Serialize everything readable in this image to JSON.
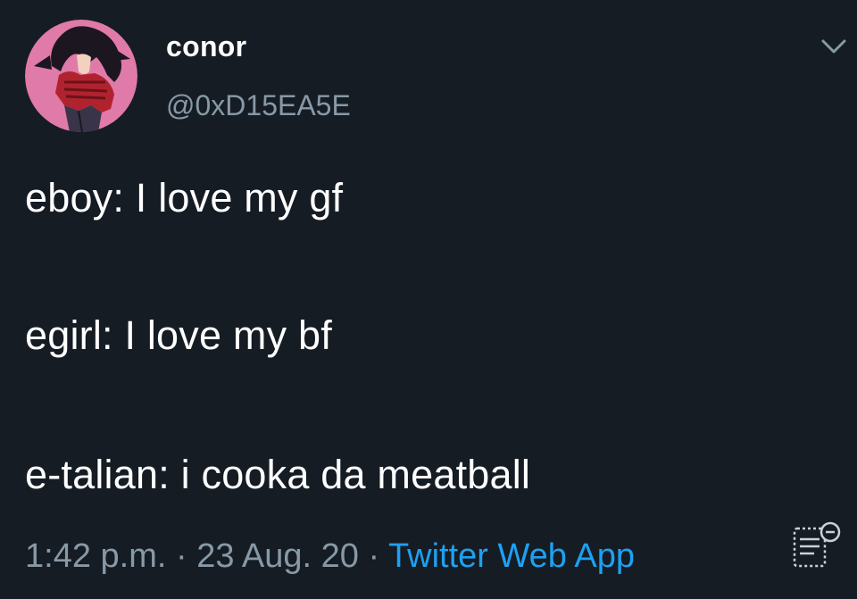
{
  "tweet": {
    "display_name": "conor",
    "handle": "@0xD15EA5E",
    "lines": [
      "eboy: I love my gf",
      "egirl: I love my bf",
      "e-talian: i cooka da meatball"
    ],
    "time": "1:42 p.m.",
    "separator": " · ",
    "date": "23 Aug. 20",
    "source": "Twitter Web App"
  },
  "icons": {
    "menu": "chevron-down-icon",
    "analytics": "analytics-icon",
    "avatar": "anime-character-avatar"
  },
  "colors": {
    "background": "#151c24",
    "primary_text": "#ffffff",
    "secondary_text": "#8899a6",
    "link": "#1da1f2",
    "avatar_bg": "#e07aa8"
  }
}
